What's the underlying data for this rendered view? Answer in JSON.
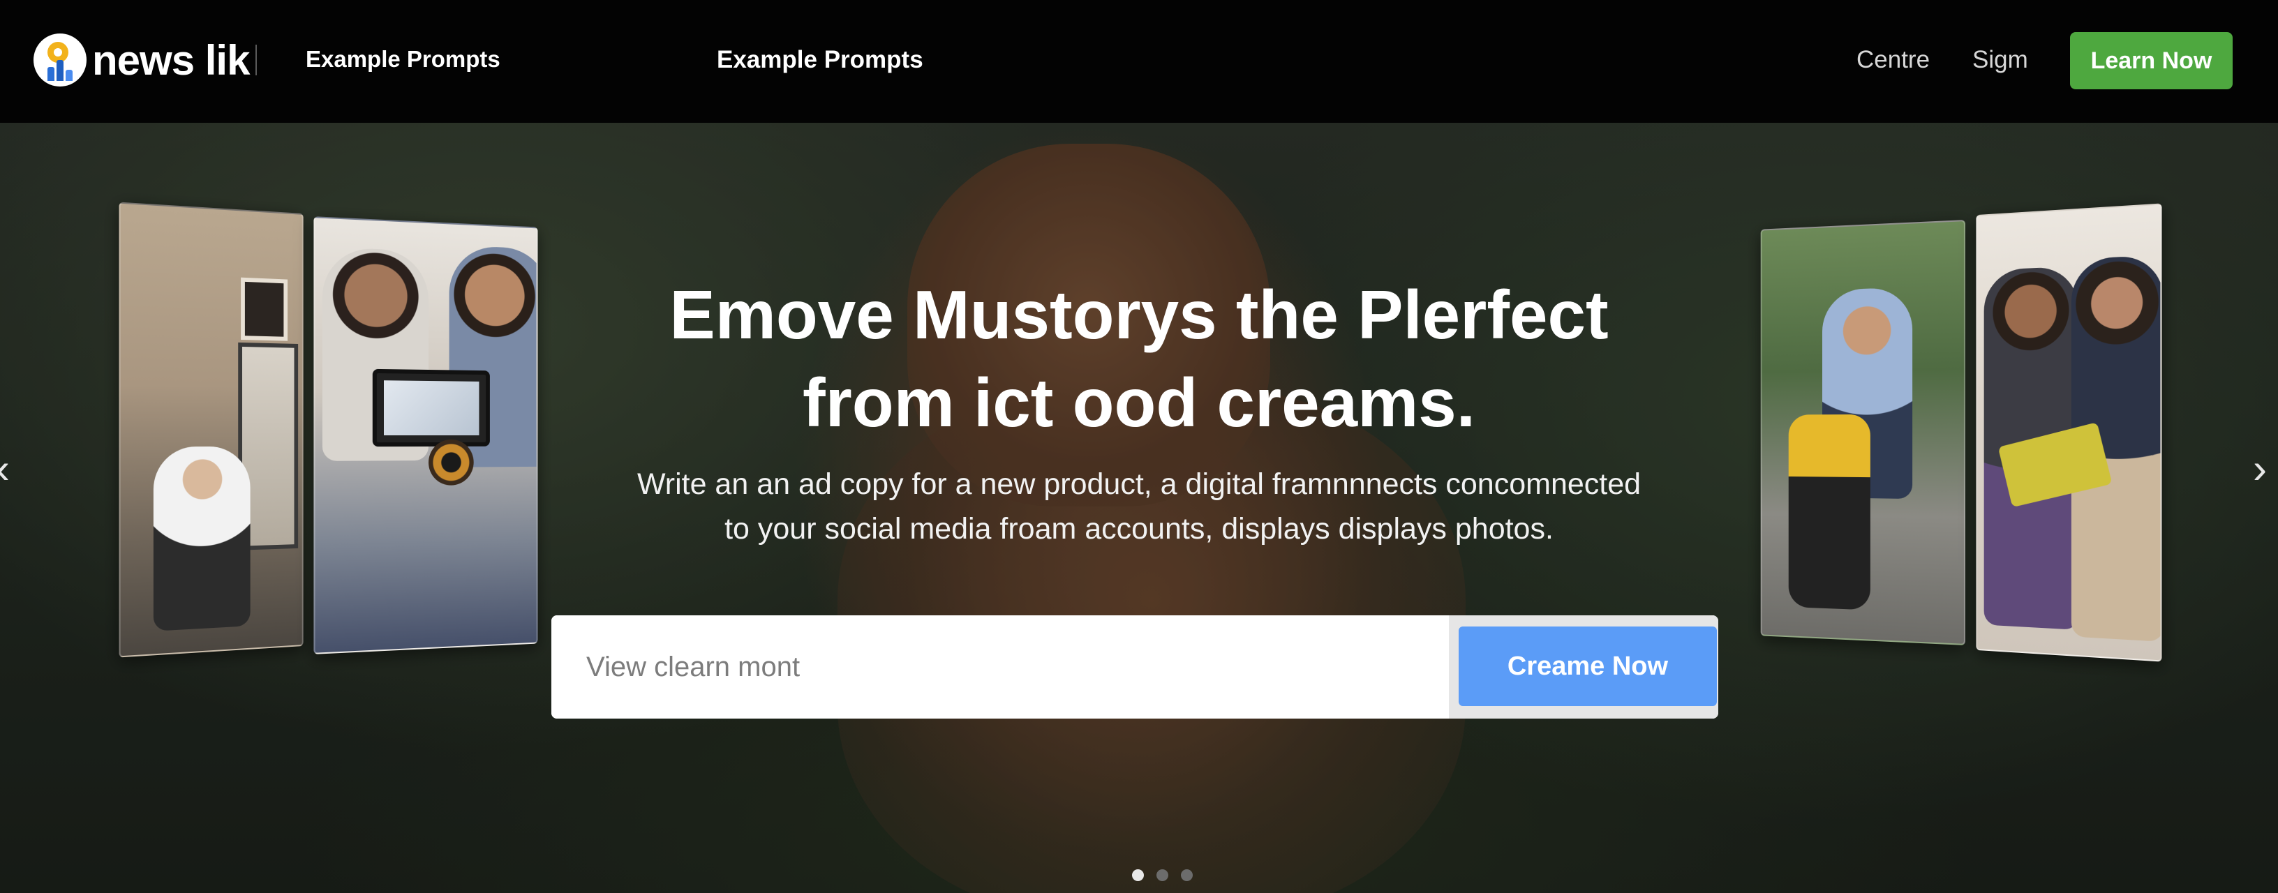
{
  "brand": {
    "name": "news lik"
  },
  "nav": {
    "left_link": "Example Prompts",
    "right_links": [
      "Example Prompts",
      "Centre",
      "Sigm"
    ],
    "cta": "Learn Now"
  },
  "hero": {
    "headline": [
      "Emove Mustorys the Plerfect",
      "from ict ood creams."
    ],
    "subtext": [
      "Write an an ad copy for a new product, a digital framnnnects concomnected",
      "to your social media froam accounts, displays displays photos."
    ],
    "search": {
      "placeholder": "View clearn mont",
      "value": ""
    },
    "submit_label": "Creame Now",
    "carousel": {
      "active_index": 0,
      "total": 3
    }
  },
  "icons": {
    "prev": "chevron-left-icon",
    "next": "chevron-right-icon",
    "logo": "sun-chart-logo-icon"
  },
  "colors": {
    "header_bg": "#030303",
    "cta_green": "#4ea83f",
    "submit_blue": "#5b9cf7"
  }
}
